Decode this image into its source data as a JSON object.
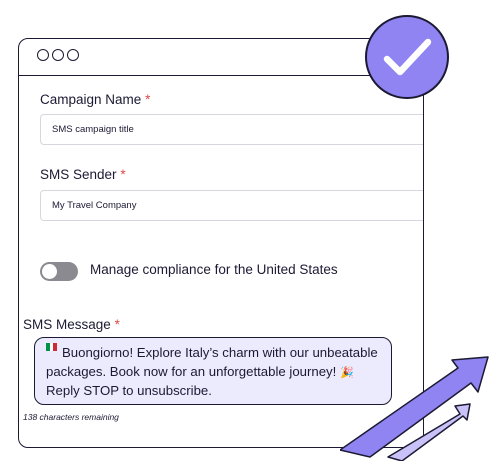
{
  "form": {
    "campaign_name": {
      "label": "Campaign Name",
      "required_mark": "*",
      "value": "SMS campaign title"
    },
    "sms_sender": {
      "label": "SMS Sender",
      "required_mark": "*",
      "value": "My Travel Company"
    },
    "compliance": {
      "label": "Manage compliance for the United States",
      "enabled": false
    },
    "sms_message": {
      "label": "SMS Message",
      "required_mark": "*",
      "text": "Buongiorno! Explore Italy’s charm with our unbeatable packages. Book now for an unforgettable journey!",
      "emoji": "🎉",
      "opt_out": "Reply STOP to unsubscribe.",
      "flag_colors": [
        "#009246",
        "#ffffff",
        "#ce2b37"
      ],
      "remaining": "138 characters remaining"
    }
  },
  "icons": {
    "window_controls": [
      "circle",
      "circle",
      "circle"
    ],
    "badge": "checkmark-icon",
    "decoration": "growth-arrows-icon"
  },
  "colors": {
    "accent": "#8f84f2",
    "message_background": "#ecebfd",
    "outline": "#1c1a33",
    "required": "#e04848",
    "toggle_off": "#8a8a90"
  }
}
